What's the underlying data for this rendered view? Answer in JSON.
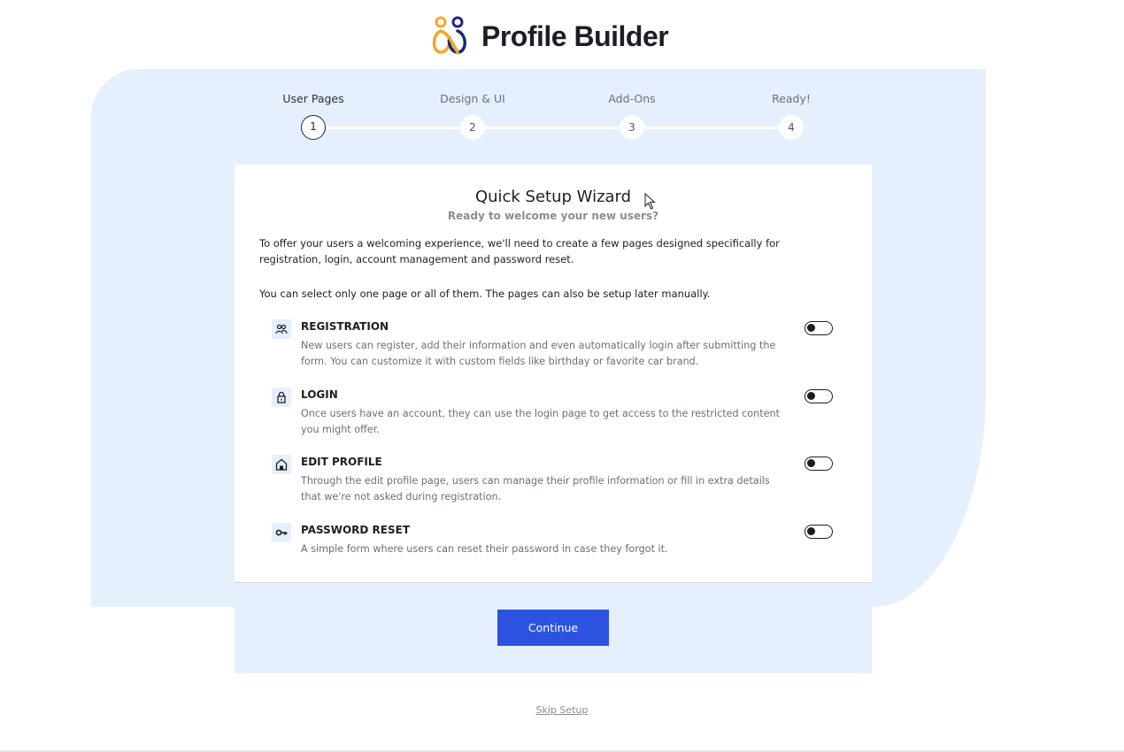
{
  "brand": {
    "name": "Profile Builder"
  },
  "steps": [
    {
      "label": "User Pages",
      "number": "1",
      "active": true
    },
    {
      "label": "Design & UI",
      "number": "2",
      "active": false
    },
    {
      "label": "Add-Ons",
      "number": "3",
      "active": false
    },
    {
      "label": "Ready!",
      "number": "4",
      "active": false
    }
  ],
  "wizard": {
    "title": "Quick Setup Wizard",
    "subtitle": "Ready to welcome your new users?",
    "intro1": "To offer your users a welcoming experience, we'll need to create a few pages designed specifically for registration, login, account management and password reset.",
    "intro2": "You can select only one page or all of them. The pages can also be setup later manually.",
    "options": [
      {
        "icon": "users-icon",
        "title": "REGISTRATION",
        "description": "New users can register, add their information and even automatically login after submitting the form. You can customize it with custom fields like birthday or favorite car brand.",
        "enabled": false
      },
      {
        "icon": "lock-icon",
        "title": "LOGIN",
        "description": "Once users have an account, they can use the login page to get access to the restricted content you might offer.",
        "enabled": false
      },
      {
        "icon": "home-icon",
        "title": "EDIT PROFILE",
        "description": "Through the edit profile page, users can manage their profile information or fill in extra details that we're not asked during registration.",
        "enabled": false
      },
      {
        "icon": "key-icon",
        "title": "PASSWORD RESET",
        "description": "A simple form where users can reset their password in case they forgot it.",
        "enabled": false
      }
    ],
    "continue_label": "Continue"
  },
  "skip_label": "Skip Setup",
  "colors": {
    "accent": "#2c52e0",
    "background_tint": "#e6effd",
    "logo_orange": "#f5a623",
    "logo_navy": "#1e2a78"
  }
}
